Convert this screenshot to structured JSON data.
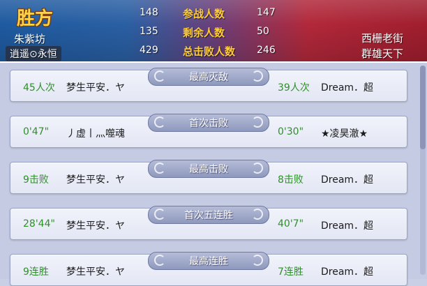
{
  "header": {
    "left_badge": "胜方",
    "left_guild": "朱紫坊",
    "left_server": "逍遥⊙永恒",
    "stats": [
      {
        "left": "148",
        "label": "参战人数",
        "right": "147"
      },
      {
        "left": "135",
        "label": "剩余人数",
        "right": "50"
      },
      {
        "left": "429",
        "label": "总击败人数",
        "right": "246"
      }
    ],
    "right_guild": "西栅老街",
    "right_server": "群雄天下"
  },
  "rows": [
    {
      "title": "最高灭敌",
      "left_value": "45人次",
      "left_name": "梦生平安．ヤ",
      "right_value": "39人次",
      "right_name": "Dream．超"
    },
    {
      "title": "首次击败",
      "left_value": "0'47\"",
      "left_name": "丿虚丨灬噬魂",
      "right_value": "0'30\"",
      "right_name": "★凌昊澈★"
    },
    {
      "title": "最高击败",
      "left_value": "9击败",
      "left_name": "梦生平安．ヤ",
      "right_value": "8击败",
      "right_name": "Dream．超"
    },
    {
      "title": "首次五连胜",
      "left_value": "28'44\"",
      "left_name": "梦生平安．ヤ",
      "right_value": "40'7\"",
      "right_name": "Dream．超"
    },
    {
      "title": "最高连胜",
      "left_value": "9连胜",
      "left_name": "梦生平安．ヤ",
      "right_value": "7连胜",
      "right_name": "Dream．超"
    }
  ]
}
